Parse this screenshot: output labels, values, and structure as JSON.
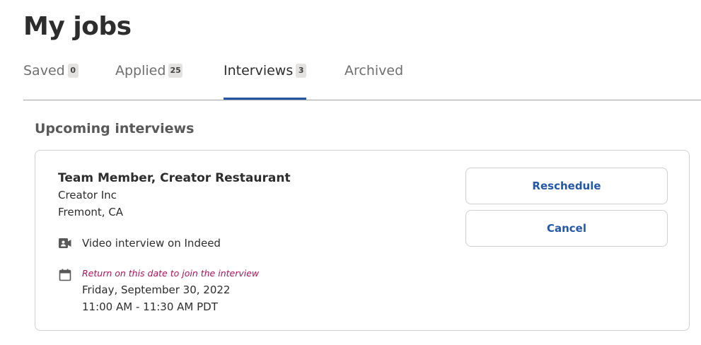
{
  "page": {
    "title": "My jobs"
  },
  "tabs": [
    {
      "label": "Saved",
      "count": "0"
    },
    {
      "label": "Applied",
      "count": "25"
    },
    {
      "label": "Interviews",
      "count": "3",
      "active": true
    },
    {
      "label": "Archived"
    }
  ],
  "section": {
    "title": "Upcoming interviews"
  },
  "interview": {
    "job_title": "Team Member, Creator Restaurant",
    "company": "Creator Inc",
    "location": "Fremont, CA",
    "type": "Video interview on Indeed",
    "type_icon": "video-camera-icon",
    "date_icon": "calendar-icon",
    "date_note": "Return on this date to join the interview",
    "date": "Friday, September 30, 2022",
    "time": "11:00 AM - 11:30 AM PDT",
    "reschedule_label": "Reschedule",
    "cancel_label": "Cancel"
  },
  "colors": {
    "accent": "#2557a7",
    "date_note": "#a9135b",
    "text": "#2d2d2d",
    "muted": "#6f6f6f"
  }
}
